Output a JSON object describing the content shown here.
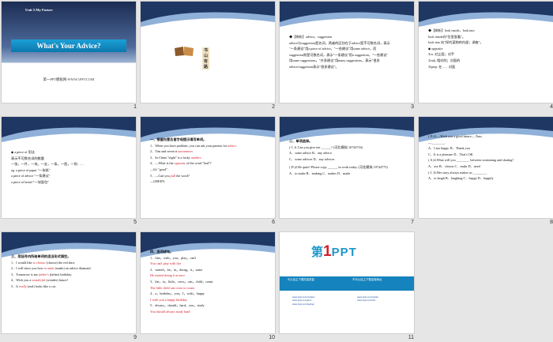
{
  "slides": [
    {
      "num": "1",
      "unit": "Unit 5    My Future",
      "title": "What's Your Advice?",
      "site": "第一PPT模板网-WWW.1PPT.COM"
    },
    {
      "num": "2",
      "label": "书山有路"
    },
    {
      "num": "3",
      "lines": [
        "◆【辨析】advice，suggestion",
        "advice与suggestion是名词，两者的区别在于advice是不可数名词，表示",
        "\"一条建议\"用a piece of advice，\"一些建议\"用some advice，而",
        "suggestion则是可数名词，表示\"一条建议\"用a suggestion，\"一些建议\"",
        "用some suggestions，\"许多建议\"用many suggestions，表示\"很多",
        "advice/suggestion表示\"很多建议\"。"
      ]
    },
    {
      "num": "4",
      "lines": [
        "◆【辨析】look inside，look into",
        "look inside向\"往里面看\"。",
        "look into 向\"探究某物的内部；调查\"。",
        "◆ opposite",
        "①n. 对立面；对手",
        "②adj. 相对的；对面的",
        "③prep. 在……对面"
      ]
    },
    {
      "num": "5",
      "lines": [
        "◆ a piece of 用法",
        "表示不可数名词的数量",
        "一张，一片，一块，一支，一条，一首，一则……",
        "eg. a piece of paper \"一张纸\"",
        "a piece of advice \"一条建议\"",
        "a piece of bread \"一块面包\""
      ]
    },
    {
      "num": "6",
      "heading": "一、根据句意及首字母提示填写单词。",
      "items": [
        {
          "pre": "1．When you have problem, you can ask your parents for",
          "ans": "advice",
          "post": "."
        },
        {
          "pre": "2．Tim and seven it",
          "ans": "uncommon",
          "post": "."
        },
        {
          "pre": "3．In China \"eight\" is a lucky",
          "ans": "number",
          "post": "."
        },
        {
          "pre": "4．—What is the",
          "ans": "opposite",
          "post": "of the word \"bad\"?"
        },
        {
          "pre": "—It's \"good\".",
          "ans": "",
          "post": ""
        },
        {
          "pre": "5．—Can you",
          "ans": "pull",
          "post": "the word?"
        },
        {
          "pre": "—GREEN.",
          "ans": "",
          "post": ""
        }
      ]
    },
    {
      "num": "7",
      "heading": "二、单项选择。",
      "lines": [
        "( C )1.Can you give me ______? (河北模拟 10744716)",
        "A．some advice  B．any advice",
        "C．some advices  D．any advices",
        "",
        "( D )2.He quite! Please copy ______ in work today. (河北模拟 10744775)",
        "A．to make  B．making  C．makes  D．made"
      ]
    },
    {
      "num": "8",
      "lines": [
        "( D )3.—Wish you a good future.—Tom.",
        "—________.",
        "A．I am happy.  B．Thank you",
        "C．It is a pleasure  D．That's OK",
        "( A )4.What will you ________ between swimming and skating?",
        "A．use  B．choose  C．make  D．need",
        "( C )5.Her story always makes us ________.",
        "A．to laugh  B．laughing  C．happy  D．happily"
      ]
    },
    {
      "num": "9",
      "heading": "三、用括号内所给单词的适当形式填空。",
      "items": [
        {
          "pre": "1．I would like",
          "ans": "to choose",
          "post": "(choose) the red shirt."
        },
        {
          "pre": "2．I will show you how",
          "ans": "to make",
          "post": "(make) an advice diamond."
        },
        {
          "pre": "3．Tomorrow is my",
          "ans": "father's",
          "post": "(father) birthday."
        },
        {
          "pre": "4．Wish you a",
          "ans": "wonderful",
          "post": "(wonder) future!"
        },
        {
          "pre": "5．It",
          "ans": "really",
          "post": "(real) looks like a cat."
        }
      ]
    },
    {
      "num": "10",
      "heading": "四、连词成句。",
      "items": [
        {
          "q": "1．fine，with，you，play，can't",
          "a": "You can't play with fire"
        },
        {
          "q": "2．started，be，in，doing，it，some",
          "a": "He started doing it at once"
        },
        {
          "q": "3．the，to，little，cross，can，child，count",
          "a": "The little child can cross to count"
        },
        {
          "q": "4．a，birthday，you，I，wish，happy",
          "a": "I wish you a happy birthday"
        },
        {
          "q": "5．always，should，hard，you，study",
          "a": "You should always study hard"
        }
      ]
    },
    {
      "num": "11",
      "logo_a": "第",
      "logo_b": "1",
      "logo_c": "PPT",
      "band_left": "可以自主下载的高质量",
      "band_right": "不可以自主下载高端地址",
      "links": [
        "www.1ppt.com/moban/",
        "www.1ppt.com/jieri/",
        "www.1ppt.com/beijing/",
        "www.1ppt.com/xiazai/",
        "www.1ppt.com/ziti/"
      ]
    }
  ]
}
